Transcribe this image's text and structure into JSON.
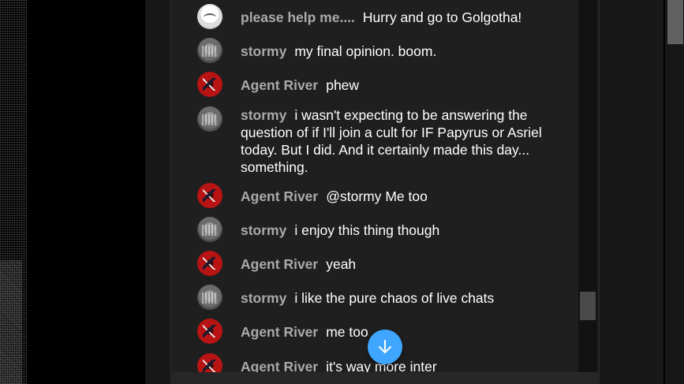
{
  "messages": [
    {
      "author": "please help me....",
      "text": "Hurry and go to Golgotha!",
      "avatar": "white"
    },
    {
      "author": "stormy",
      "text": "my final opinion. boom.",
      "avatar": "gray"
    },
    {
      "author": "Agent River",
      "text": "phew",
      "avatar": "red"
    },
    {
      "author": "stormy",
      "text": "i wasn't expecting to be answering the question of if I'll join a cult for IF Papyrus or Asriel today. But I did. And it certainly made this day... something.",
      "avatar": "gray"
    },
    {
      "author": "Agent River",
      "text": "@stormy Me too",
      "avatar": "red"
    },
    {
      "author": "stormy",
      "text": "i enjoy this thing though",
      "avatar": "gray"
    },
    {
      "author": "Agent River",
      "text": "yeah",
      "avatar": "red"
    },
    {
      "author": "stormy",
      "text": "i like the pure chaos of live chats",
      "avatar": "gray"
    },
    {
      "author": "Agent River",
      "text": "me too",
      "avatar": "red"
    },
    {
      "author": "Agent River",
      "text": "it's way more inter",
      "avatar": "red"
    }
  ],
  "scroll_down_icon": "arrow-down-icon",
  "colors": {
    "accent": "#3ea6ff",
    "author": "#aaaaaa",
    "message": "#ffffff",
    "panel": "#1f1f1f"
  }
}
